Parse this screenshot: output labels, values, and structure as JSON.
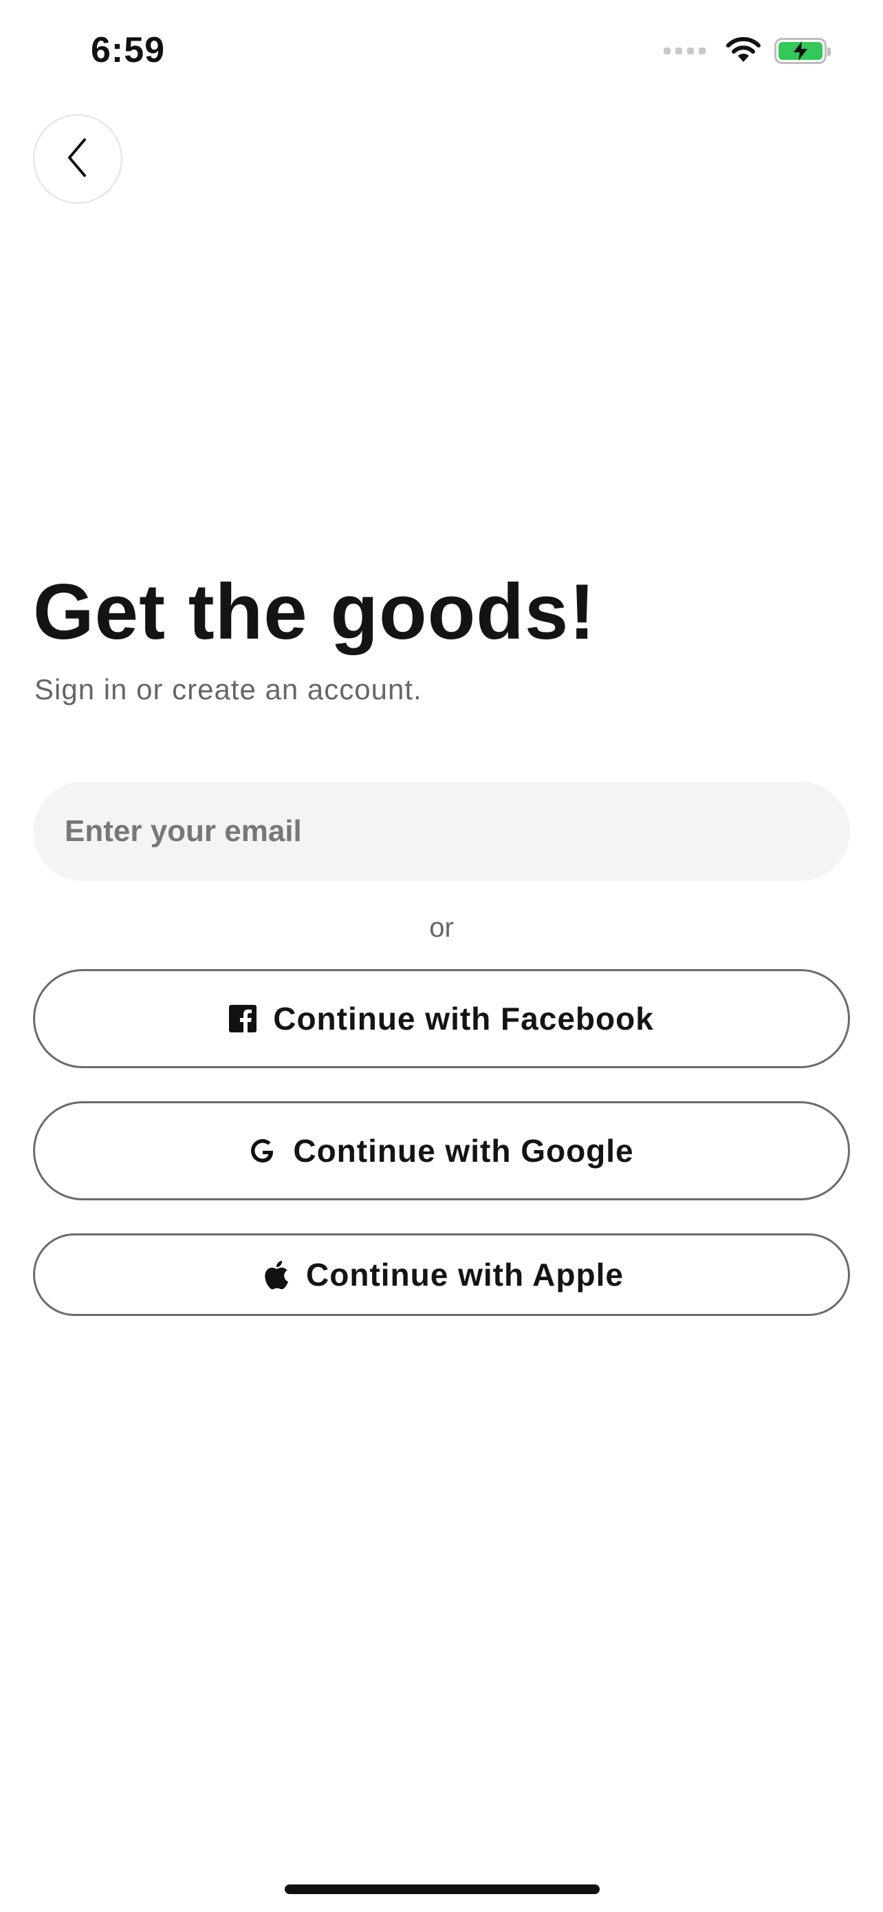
{
  "status_bar": {
    "time": "6:59",
    "icons": [
      "cellular-signal-icon",
      "wifi-icon",
      "battery-charging-icon"
    ],
    "battery_color": "#34c759"
  },
  "header": {
    "back_icon": "chevron-left-icon"
  },
  "main": {
    "title": "Get the goods!",
    "subtitle": "Sign in or create an account.",
    "email_placeholder": "Enter your email",
    "email_value": "",
    "divider_text": "or",
    "buttons": {
      "facebook": {
        "label": "Continue with Facebook",
        "icon": "facebook-icon"
      },
      "google": {
        "label": "Continue with Google",
        "icon": "google-icon"
      },
      "apple": {
        "label": "Continue with Apple",
        "icon": "apple-icon"
      }
    }
  },
  "colors": {
    "text_primary": "#141414",
    "text_secondary": "#666666",
    "input_background": "#f4f4f4",
    "button_border": "#6b6b6b"
  }
}
